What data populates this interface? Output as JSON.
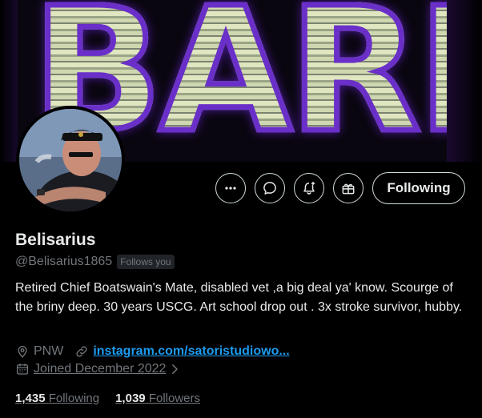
{
  "banner": {
    "text": "BARN"
  },
  "actions": {
    "more_icon": "more-horizontal-icon",
    "message_icon": "message-bubble-icon",
    "notify_icon": "bell-plus-icon",
    "subscribe_icon": "gift-icon",
    "following_label": "Following"
  },
  "profile": {
    "name": "Belisarius",
    "handle": "@Belisarius1865",
    "follows_you": "Follows you",
    "bio": "Retired Chief Boatswain's Mate, disabled vet ,a big deal ya' know. Scourge of the briny deep. 30 years USCG. Art school drop out . 3x stroke survivor, hubby.",
    "location": "PNW",
    "website": "instagram.com/satoristudiowo...",
    "joined": "Joined December 2022"
  },
  "stats": {
    "following_count": "1,435",
    "following_label": "Following",
    "followers_count": "1,039",
    "followers_label": "Followers"
  },
  "colors": {
    "accent": "#1d9bf0",
    "muted": "#71767b",
    "text": "#e7e9ea",
    "banner_outline": "#6a2fc8"
  }
}
